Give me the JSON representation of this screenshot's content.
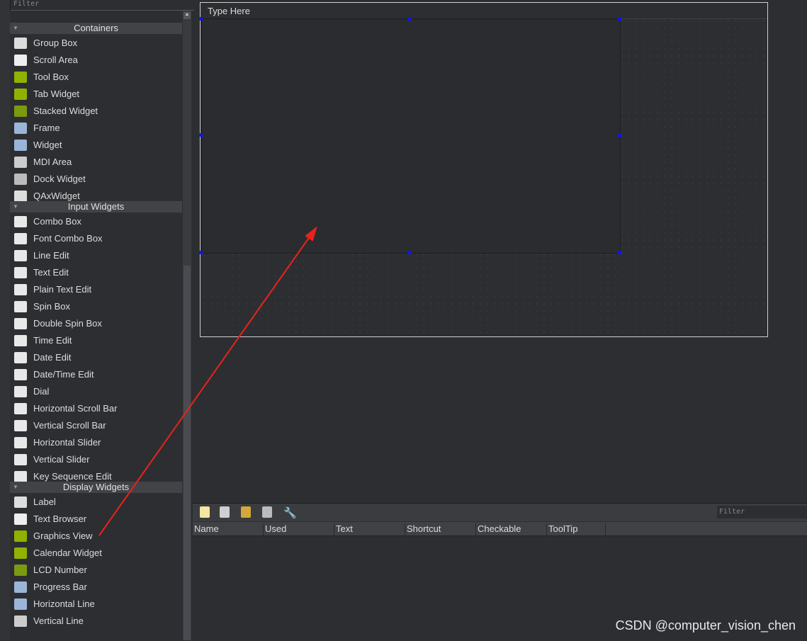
{
  "widget_box": {
    "filter_placeholder": "Filter",
    "categories": [
      {
        "label": "Containers",
        "items": [
          "Group Box",
          "Scroll Area",
          "Tool Box",
          "Tab Widget",
          "Stacked Widget",
          "Frame",
          "Widget",
          "MDI Area",
          "Dock Widget",
          "QAxWidget"
        ]
      },
      {
        "label": "Input Widgets",
        "items": [
          "Combo Box",
          "Font Combo Box",
          "Line Edit",
          "Text Edit",
          "Plain Text Edit",
          "Spin Box",
          "Double Spin Box",
          "Time Edit",
          "Date Edit",
          "Date/Time Edit",
          "Dial",
          "Horizontal Scroll Bar",
          "Vertical Scroll Bar",
          "Horizontal Slider",
          "Vertical Slider",
          "Key Sequence Edit"
        ]
      },
      {
        "label": "Display Widgets",
        "items": [
          "Label",
          "Text Browser",
          "Graphics View",
          "Calendar Widget",
          "LCD Number",
          "Progress Bar",
          "Horizontal Line",
          "Vertical Line"
        ]
      }
    ]
  },
  "form": {
    "menubar_placeholder": "Type Here"
  },
  "action_editor": {
    "filter_placeholder": "Filter",
    "toolbar_icons": [
      "new-action-icon",
      "copy-action-icon",
      "paste-action-icon",
      "delete-action-icon",
      "configure-icon"
    ],
    "columns": [
      "Name",
      "Used",
      "Text",
      "Shortcut",
      "Checkable",
      "ToolTip"
    ]
  },
  "watermark": "CSDN @computer_vision_chen",
  "colors": {
    "arrow": "#e8231c",
    "handle": "#1212ff",
    "icon_green": "#8fb200"
  }
}
